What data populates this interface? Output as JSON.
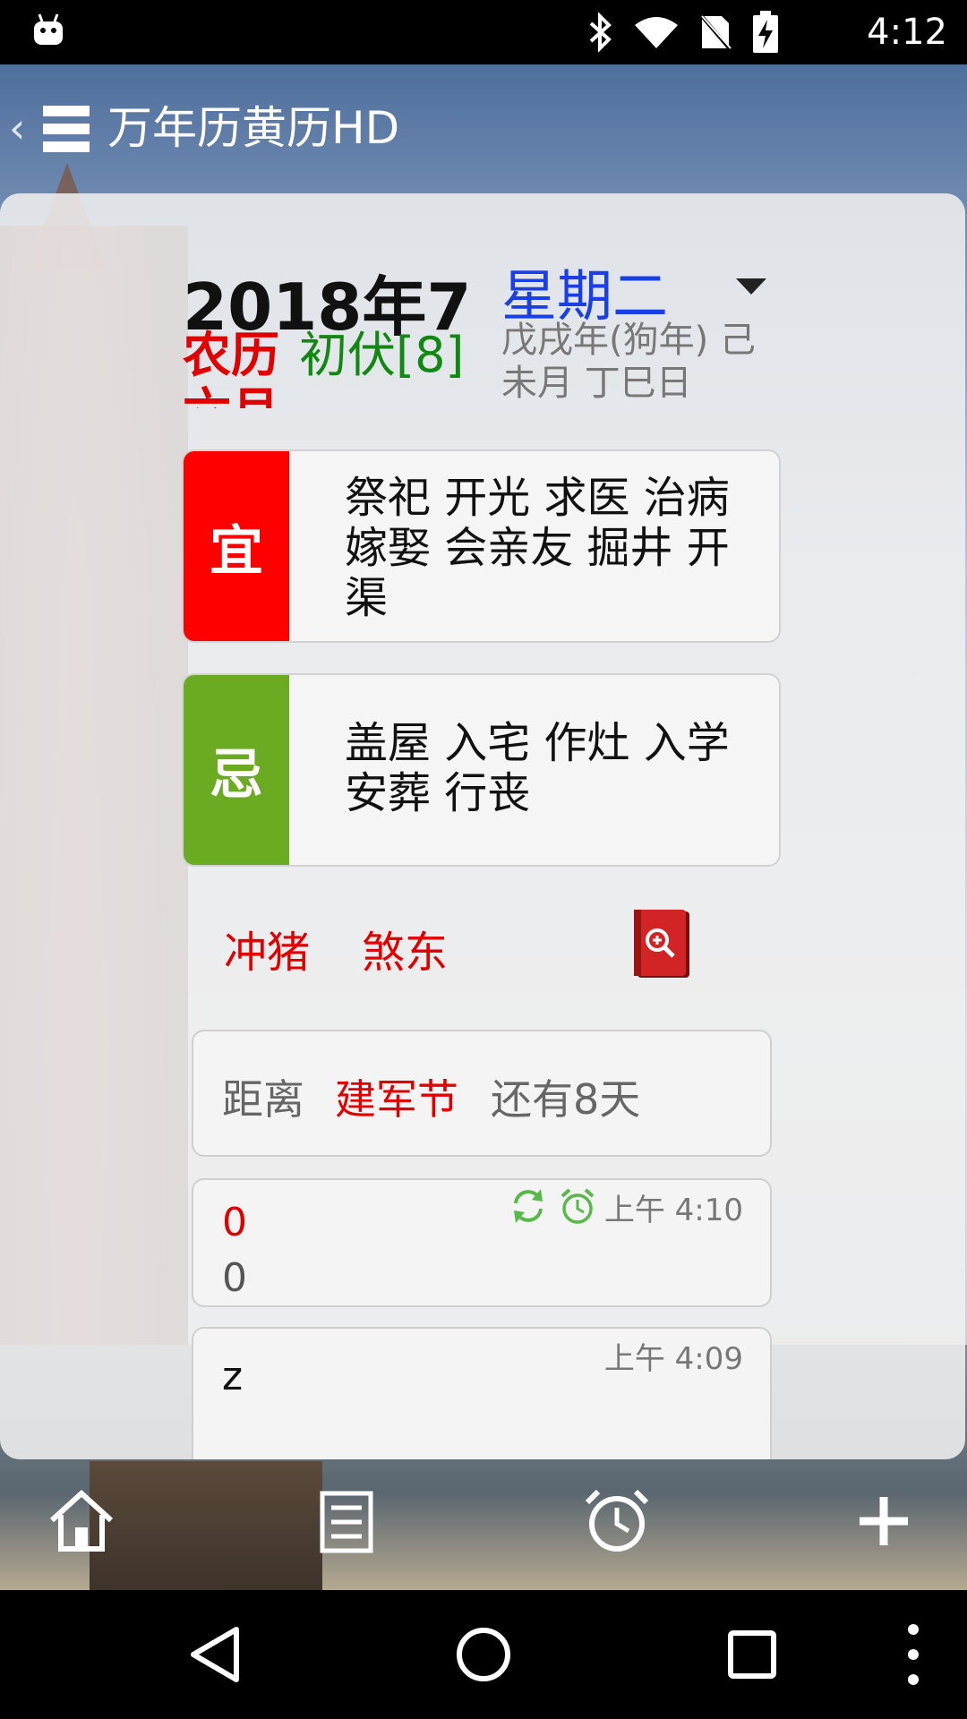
{
  "status_bar": {
    "time": "4:12",
    "icons": [
      "android-debug-icon",
      "bluetooth-icon",
      "wifi-icon",
      "no-sim-icon",
      "battery-charging-icon"
    ]
  },
  "header": {
    "title": "万年历黄历HD"
  },
  "date": {
    "headline": "2018年7",
    "weekday": "星期二",
    "lunar_label": "农历六月",
    "lunar_term": "初伏[8]",
    "ganzhi": "戊戌年(狗年) 己未月 丁巳日"
  },
  "almanac": {
    "yi_tag": "宜",
    "yi_text": "祭祀 开光 求医 治病 嫁娶 会亲友 掘井 开渠",
    "ji_tag": "忌",
    "ji_text": "盖屋 入宅 作灶 入学 安葬 行丧",
    "chong": "冲猪",
    "sha": "煞东"
  },
  "festival": {
    "prefix": "距离",
    "name": "建军节",
    "suffix": "还有8天"
  },
  "notes": [
    {
      "title": "0",
      "body": "0",
      "time": "上午 4:10"
    },
    {
      "title": "z",
      "body": "",
      "time": "上午 4:09"
    }
  ],
  "colors": {
    "yi": "#ff0000",
    "ji": "#6aab22",
    "weekday": "#1a3fe6",
    "accent_red": "#e00000",
    "reminder_green": "#58b84a"
  }
}
